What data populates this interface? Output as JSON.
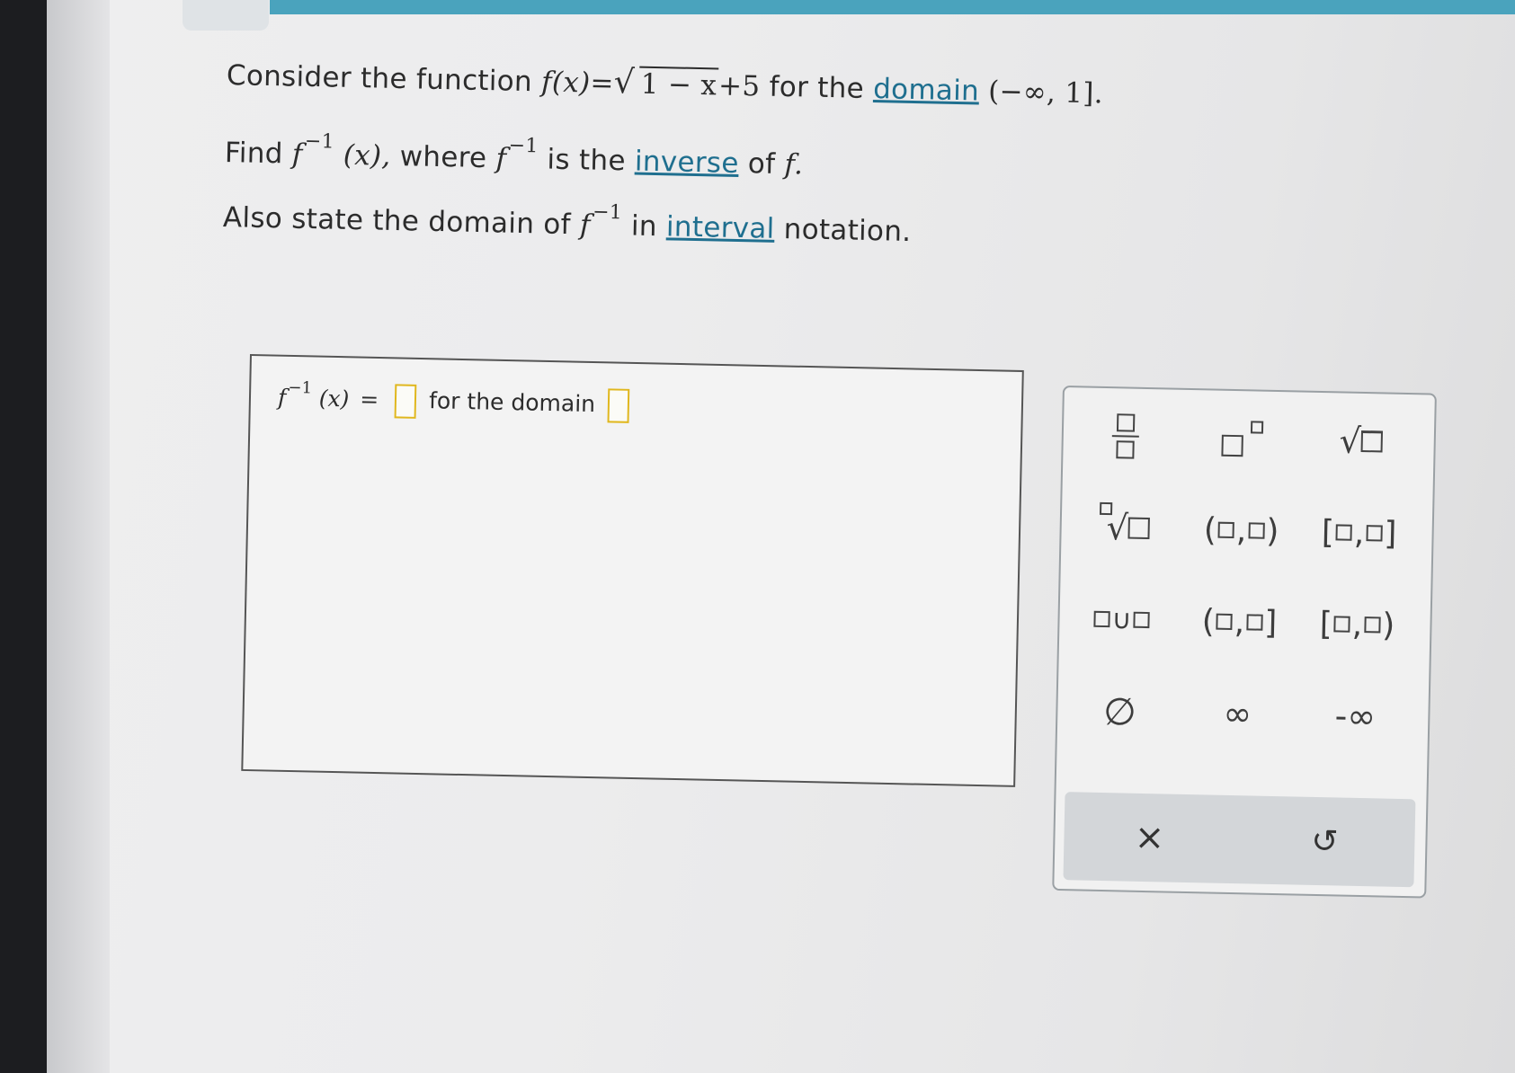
{
  "question": {
    "line1": {
      "prefix": "Consider the function",
      "f": "f",
      "x_paren": "(x)",
      "eq": "=",
      "radicand": "1 − x",
      "plus": "+5",
      "middle": "for the",
      "domain_link": "domain",
      "domain": "(−∞, 1]."
    },
    "line2": {
      "prefix": "Find",
      "f": "f",
      "sup": "−1",
      "x_paren": "(x),",
      "where": "where",
      "f2": "f",
      "sup2": "−1",
      "is_the": "is the",
      "inverse_link": "inverse",
      "of": "of",
      "f3": "f."
    },
    "line3": {
      "prefix": "Also state the domain of",
      "f": "f",
      "sup": "−1",
      "in": "in",
      "interval_link": "interval",
      "notation": "notation."
    }
  },
  "answer": {
    "f": "f",
    "sup": "−1",
    "x_paren": "(x)",
    "eq": "=",
    "for_the_domain": "for the domain"
  },
  "keypad": {
    "keys": {
      "fraction": "",
      "exponent": "",
      "sqrt_symbol": "√",
      "nthroot_symbol": "√",
      "open_open_l": "(",
      "open_open_c": ",",
      "open_open_r": ")",
      "closed_closed_l": "[",
      "closed_closed_c": ",",
      "closed_closed_r": "]",
      "union_symbol": "∪",
      "open_closed_l": "(",
      "open_closed_c": ",",
      "open_closed_r": "]",
      "closed_open_l": "[",
      "closed_open_c": ",",
      "closed_open_r": ")",
      "empty_set": "∅",
      "infinity": "∞",
      "neg_infinity": "-∞"
    },
    "clear": "×",
    "undo": "↺"
  },
  "colors": {
    "accent": "#4aa3bd",
    "link": "#1f6f8f",
    "slot_border": "#e0b71e",
    "keypad_bar": "#d3d6d9"
  }
}
